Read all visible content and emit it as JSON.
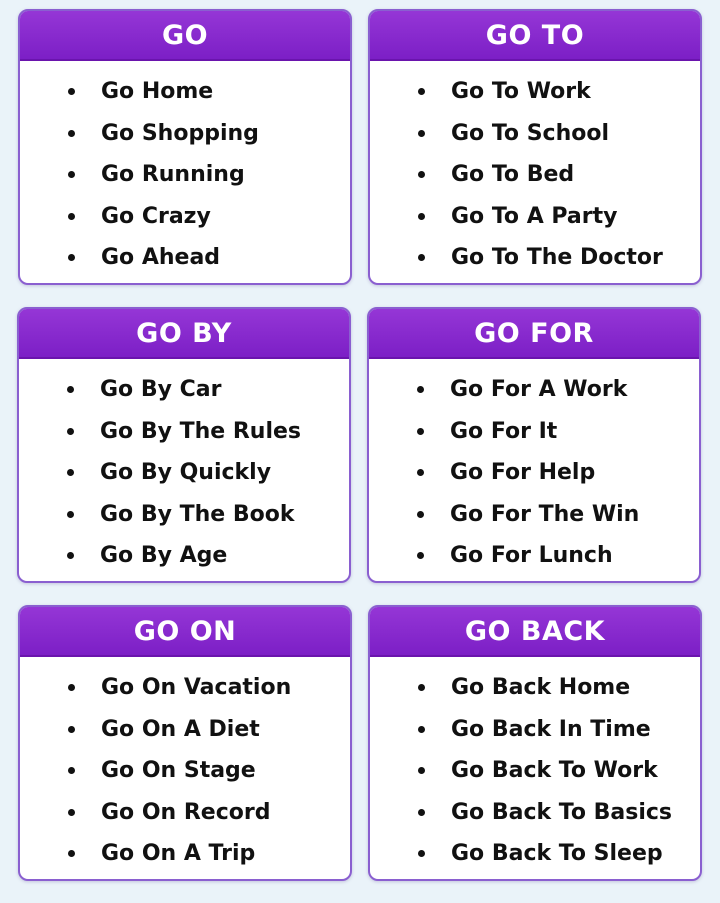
{
  "cards": [
    {
      "title": "GO",
      "items": [
        "Go Home",
        "Go Shopping",
        "Go Running",
        "Go Crazy",
        "Go Ahead"
      ]
    },
    {
      "title": "GO TO",
      "items": [
        "Go To Work",
        "Go To School",
        "Go To Bed",
        "Go To A Party",
        "Go To The Doctor"
      ]
    },
    {
      "title": "GO BY",
      "items": [
        "Go By Car",
        "Go By The Rules",
        "Go By Quickly",
        "Go By The Book",
        "Go By Age"
      ]
    },
    {
      "title": "GO FOR",
      "items": [
        "Go For A Work",
        "Go For It",
        "Go For Help",
        "Go For The Win",
        "Go For Lunch"
      ]
    },
    {
      "title": "GO ON",
      "items": [
        "Go On Vacation",
        "Go On A Diet",
        "Go On Stage",
        "Go On Record",
        "Go On A Trip"
      ]
    },
    {
      "title": "GO BACK",
      "items": [
        "Go Back Home",
        "Go Back In Time",
        "Go Back To Work",
        "Go Back To Basics",
        "Go Back To Sleep"
      ]
    }
  ],
  "colors": {
    "header": "#8a2fd2",
    "border": "#8a5fd0",
    "background": "#eaf3f9",
    "text": "#111111"
  }
}
